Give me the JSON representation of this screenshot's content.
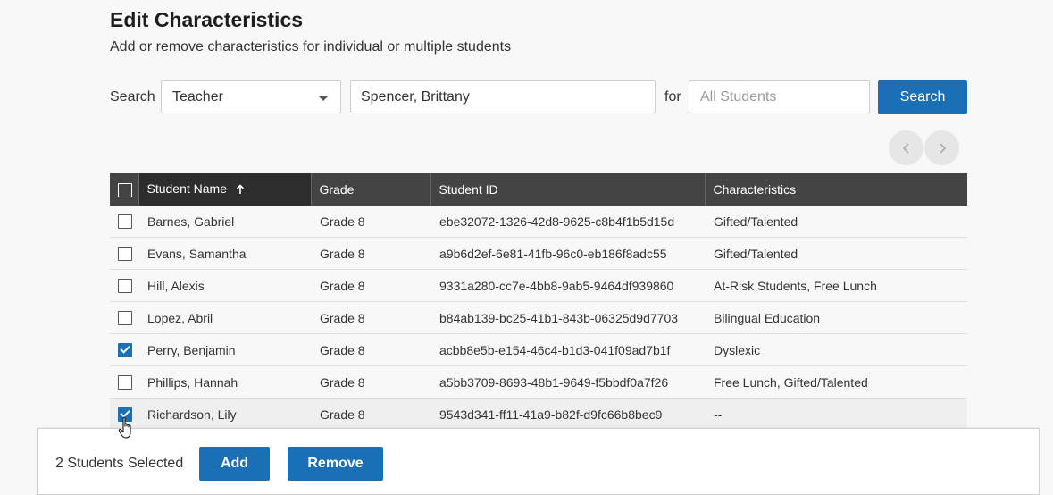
{
  "page": {
    "title": "Edit Characteristics",
    "subtitle": "Add or remove characteristics for individual or multiple students"
  },
  "search": {
    "label": "Search",
    "type_selected": "Teacher",
    "query_value": "Spencer, Brittany",
    "for_label": "for",
    "students_placeholder": "All Students",
    "button_label": "Search"
  },
  "pagination": {
    "prev_icon": "chevron-left-icon",
    "next_icon": "chevron-right-icon"
  },
  "table": {
    "headers": {
      "name": "Student Name",
      "grade": "Grade",
      "id": "Student ID",
      "characteristics": "Characteristics"
    },
    "sort": {
      "column": "name",
      "direction": "ascending"
    },
    "rows": [
      {
        "checked": false,
        "name": "Barnes, Gabriel",
        "grade": "Grade 8",
        "id": "ebe32072-1326-42d8-9625-c8b4f1b5d15d",
        "characteristics": "Gifted/Talented"
      },
      {
        "checked": false,
        "name": "Evans, Samantha",
        "grade": "Grade 8",
        "id": "a9b6d2ef-6e81-41fb-96c0-eb186f8adc55",
        "characteristics": "Gifted/Talented"
      },
      {
        "checked": false,
        "name": "Hill, Alexis",
        "grade": "Grade 8",
        "id": "9331a280-cc7e-4bb8-9ab5-9464df939860",
        "characteristics": "At-Risk Students, Free Lunch"
      },
      {
        "checked": false,
        "name": "Lopez, Abril",
        "grade": "Grade 8",
        "id": "b84ab139-bc25-41b1-843b-06325d9d7703",
        "characteristics": "Bilingual Education"
      },
      {
        "checked": true,
        "name": "Perry, Benjamin",
        "grade": "Grade 8",
        "id": "acbb8e5b-e154-46c4-b1d3-041f09ad7b1f",
        "characteristics": "Dyslexic"
      },
      {
        "checked": false,
        "name": "Phillips, Hannah",
        "grade": "Grade 8",
        "id": "a5bb3709-8693-48b1-9649-f5bbdf0a7f26",
        "characteristics": "Free Lunch, Gifted/Talented"
      },
      {
        "checked": true,
        "name": "Richardson, Lily",
        "grade": "Grade 8",
        "id": "9543d341-ff11-41a9-b82f-d9fc66b8bec9",
        "characteristics": "--"
      }
    ]
  },
  "footer": {
    "selected_text": "2 Students Selected",
    "add_label": "Add",
    "remove_label": "Remove"
  },
  "colors": {
    "accent": "#1a6fb5",
    "header_bg": "#444444",
    "sorted_header_bg": "#2d2d2d"
  }
}
